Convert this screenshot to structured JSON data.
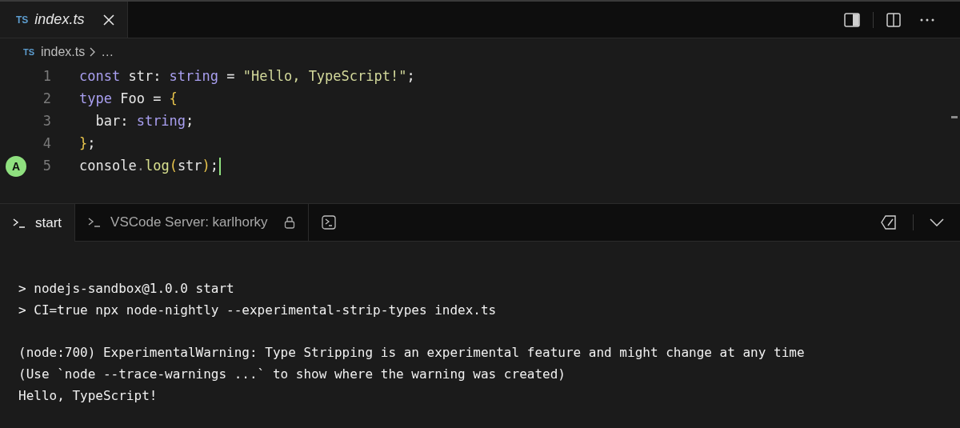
{
  "editor_tabs": [
    {
      "icon_text": "TS",
      "label": "index.ts",
      "selected": true,
      "italic": true
    }
  ],
  "breadcrumb": {
    "icon_text": "TS",
    "file": "index.ts",
    "more": "…"
  },
  "code_lines": [
    {
      "number": "1",
      "cursor": false,
      "tokens": [
        {
          "t": "const",
          "kind": "keyword"
        },
        {
          "t": " str: ",
          "kind": "plain"
        },
        {
          "t": "string",
          "kind": "keyword"
        },
        {
          "t": " = ",
          "kind": "plain"
        },
        {
          "t": "\"Hello, TypeScript!\"",
          "kind": "string"
        },
        {
          "t": ";",
          "kind": "plain"
        }
      ]
    },
    {
      "number": "2",
      "cursor": false,
      "tokens": [
        {
          "t": "type",
          "kind": "keyword"
        },
        {
          "t": " Foo = ",
          "kind": "plain"
        },
        {
          "t": "{",
          "kind": "brace"
        }
      ]
    },
    {
      "number": "3",
      "cursor": false,
      "tokens": [
        {
          "t": "  bar: ",
          "kind": "plain"
        },
        {
          "t": "string",
          "kind": "keyword"
        },
        {
          "t": ";",
          "kind": "plain"
        }
      ]
    },
    {
      "number": "4",
      "cursor": false,
      "tokens": [
        {
          "t": "}",
          "kind": "brace"
        },
        {
          "t": ";",
          "kind": "plain"
        }
      ]
    },
    {
      "number": "5",
      "badge": "A",
      "cursor": true,
      "tokens": [
        {
          "t": "console",
          "kind": "plain"
        },
        {
          "t": ".",
          "kind": "dim"
        },
        {
          "t": "log",
          "kind": "function"
        },
        {
          "t": "(",
          "kind": "brace"
        },
        {
          "t": "str",
          "kind": "plain"
        },
        {
          "t": ")",
          "kind": "brace"
        },
        {
          "t": ";",
          "kind": "plain"
        }
      ]
    }
  ],
  "terminal_tabs": [
    {
      "label": "start",
      "selected": true,
      "locked": false
    },
    {
      "label": "VSCode Server: karlhorky",
      "selected": false,
      "locked": true
    }
  ],
  "terminal_blocks": [
    [
      "> nodejs-sandbox@1.0.0 start",
      "> CI=true npx node-nightly --experimental-strip-types index.ts"
    ],
    [
      "(node:700) ExperimentalWarning: Type Stripping is an experimental feature and might change at any time",
      "(Use `node --trace-warnings ...` to show where the warning was created)",
      "Hello, TypeScript!"
    ]
  ]
}
